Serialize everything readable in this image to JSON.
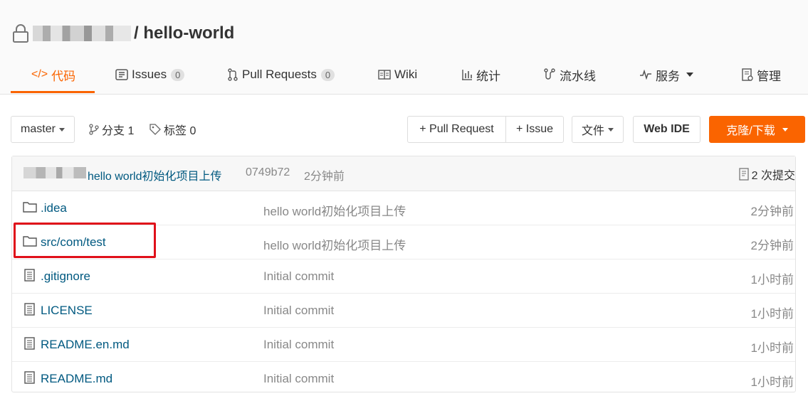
{
  "repo": {
    "name": "/ hello-world",
    "owner_hidden": true
  },
  "tabs": [
    {
      "label": "代码",
      "icon": "code-icon",
      "active": true
    },
    {
      "label": "Issues",
      "icon": "issues-icon",
      "badge": "0"
    },
    {
      "label": "Pull Requests",
      "icon": "pull-request-icon",
      "badge": "0"
    },
    {
      "label": "Wiki",
      "icon": "wiki-icon"
    },
    {
      "label": "统计",
      "icon": "stats-icon"
    },
    {
      "label": "流水线",
      "icon": "pipeline-icon"
    },
    {
      "label": "服务",
      "icon": "service-icon",
      "dropdown": true
    },
    {
      "label": "管理",
      "icon": "manage-icon"
    }
  ],
  "toolbar": {
    "branch": "master",
    "branches": "分支 1",
    "tags": "标签 0",
    "pull_request_btn": "+ Pull Request",
    "issue_btn": "+ Issue",
    "files_btn": "文件",
    "web_ide_btn": "Web IDE",
    "clone_btn": "克隆/下载"
  },
  "latest_commit": {
    "message": "hello world初始化项目上传",
    "sha": "0749b72",
    "time": "2分钟前",
    "count": "2 次提交"
  },
  "files": [
    {
      "type": "folder",
      "name": ".idea",
      "message": "hello world初始化项目上传",
      "time": "2分钟前"
    },
    {
      "type": "folder",
      "name": "src/com/test",
      "message": "hello world初始化项目上传",
      "time": "2分钟前"
    },
    {
      "type": "file",
      "name": ".gitignore",
      "message": "Initial commit",
      "time": "1小时前"
    },
    {
      "type": "file",
      "name": "LICENSE",
      "message": "Initial commit",
      "time": "1小时前"
    },
    {
      "type": "file",
      "name": "README.en.md",
      "message": "Initial commit",
      "time": "1小时前"
    },
    {
      "type": "file",
      "name": "README.md",
      "message": "Initial commit",
      "time": "1小时前"
    }
  ],
  "colors": {
    "accent": "#fa6400",
    "link": "#005980",
    "highlight": "#e0101a"
  }
}
